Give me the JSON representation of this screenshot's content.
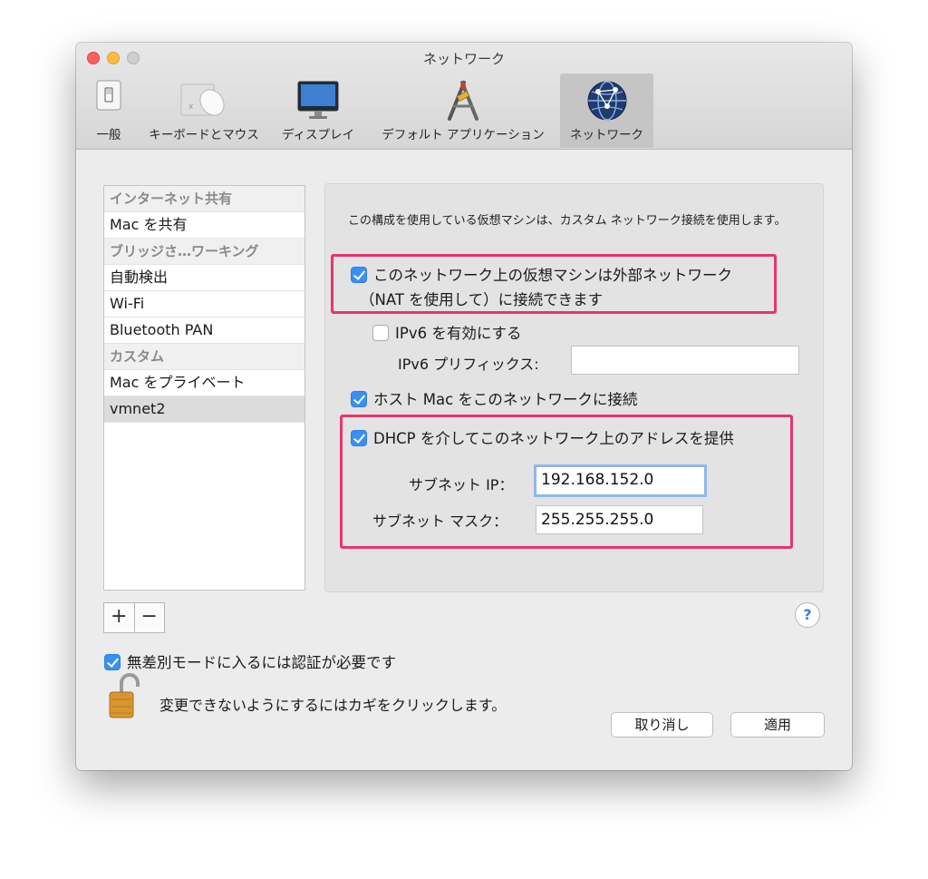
{
  "window": {
    "title": "ネットワーク"
  },
  "toolbar": {
    "items": [
      {
        "label": "一般",
        "icon": "general-switch-icon"
      },
      {
        "label": "キーボードとマウス",
        "icon": "keyboard-mouse-icon"
      },
      {
        "label": "ディスプレイ",
        "icon": "display-icon"
      },
      {
        "label": "デフォルト アプリケーション",
        "icon": "default-applications-icon"
      },
      {
        "label": "ネットワーク",
        "icon": "network-globe-icon",
        "active": true
      }
    ]
  },
  "sidebar": {
    "rows": [
      {
        "label": "インターネット共有",
        "type": "header"
      },
      {
        "label": "Mac を共有",
        "type": "item"
      },
      {
        "label": "ブリッジさ…ワーキング",
        "type": "header"
      },
      {
        "label": "自動検出",
        "type": "item"
      },
      {
        "label": "Wi-Fi",
        "type": "item"
      },
      {
        "label": "Bluetooth PAN",
        "type": "item"
      },
      {
        "label": "カスタム",
        "type": "header"
      },
      {
        "label": "Mac をプライベート",
        "type": "item"
      },
      {
        "label": "vmnet2",
        "type": "item",
        "selected": true
      }
    ],
    "add_label": "+",
    "remove_label": "−"
  },
  "panel": {
    "description": "この構成を使用している仮想マシンは、カスタム ネットワーク接続を使用します。",
    "nat": {
      "checked": true,
      "line1": "このネットワーク上の仮想マシンは外部ネットワーク",
      "line2": "（NAT を使用して）に接続できます"
    },
    "ipv6": {
      "checked": false,
      "label": "IPv6 を有効にする",
      "prefix_label": "IPv6 プリフィックス:",
      "prefix_value": ""
    },
    "host": {
      "checked": true,
      "label": "ホスト Mac をこのネットワークに接続"
    },
    "dhcp": {
      "checked": true,
      "label": "DHCP を介してこのネットワーク上のアドレスを提供",
      "subnet_ip_label": "サブネット IP：",
      "subnet_ip": "192.168.152.0",
      "subnet_mask_label": "サブネット マスク：",
      "subnet_mask": "255.255.255.0"
    }
  },
  "footer": {
    "help": "?",
    "auth_checked": true,
    "auth_label": "無差別モードに入るには認証が必要です",
    "lock_text": "変更できないようにするにはカギをクリックします。",
    "cancel": "取り消し",
    "apply": "適用"
  },
  "colors": {
    "accent": "#3a8ff5",
    "highlight": "#e8346e"
  }
}
